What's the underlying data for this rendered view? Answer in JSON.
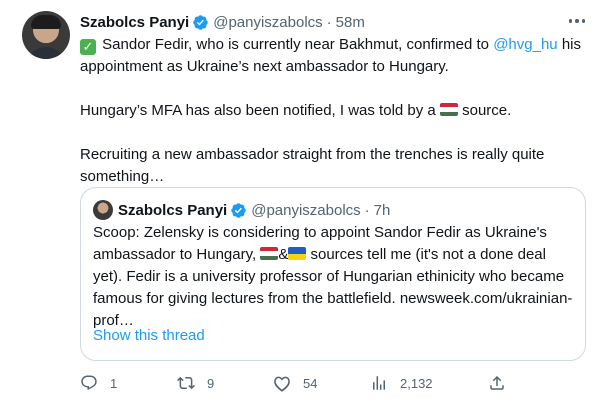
{
  "tweet": {
    "author_name": "Szabolcs Panyi",
    "author_handle": "@panyiszabolcs",
    "separator": "·",
    "time": "58m",
    "line1_pre": "Sandor Fedir, who is currently near Bakhmut, confirmed to ",
    "line1_link": "@hvg_hu",
    "line1_post": "his appointment as Ukraine’s next ambassador to Hungary.",
    "para2_pre": "Hungary’s MFA has also been notified, I was told by a ",
    "para2_post": " source.",
    "para3": "Recruiting a new ambassador straight from the trenches is really quite something…"
  },
  "quote": {
    "author_name": "Szabolcs Panyi",
    "author_handle": "@panyiszabolcs",
    "separator": "·",
    "time": "7h",
    "text_pre": "Scoop: Zelensky is considering to appoint Sandor Fedir as Ukraine's ambassador to Hungary, ",
    "text_amp": "&",
    "text_post": " sources tell me (it's not a done deal yet). Fedir is a university professor of Hungarian ethinicity who became famous for giving lectures from the battlefield.",
    "link": "newsweek.com/ukrainian-prof…",
    "show_thread": "Show this thread"
  },
  "actions": {
    "replies": "1",
    "retweets": "9",
    "likes": "54",
    "views": "2,132"
  },
  "colors": {
    "accent": "#1d9bf0",
    "secondary_text": "#536471",
    "border": "#cfd9de",
    "check_emoji": "#4caf50"
  },
  "icons": [
    "verified-badge-icon",
    "more-icon",
    "reply-icon",
    "retweet-icon",
    "like-icon",
    "views-icon",
    "share-icon"
  ]
}
